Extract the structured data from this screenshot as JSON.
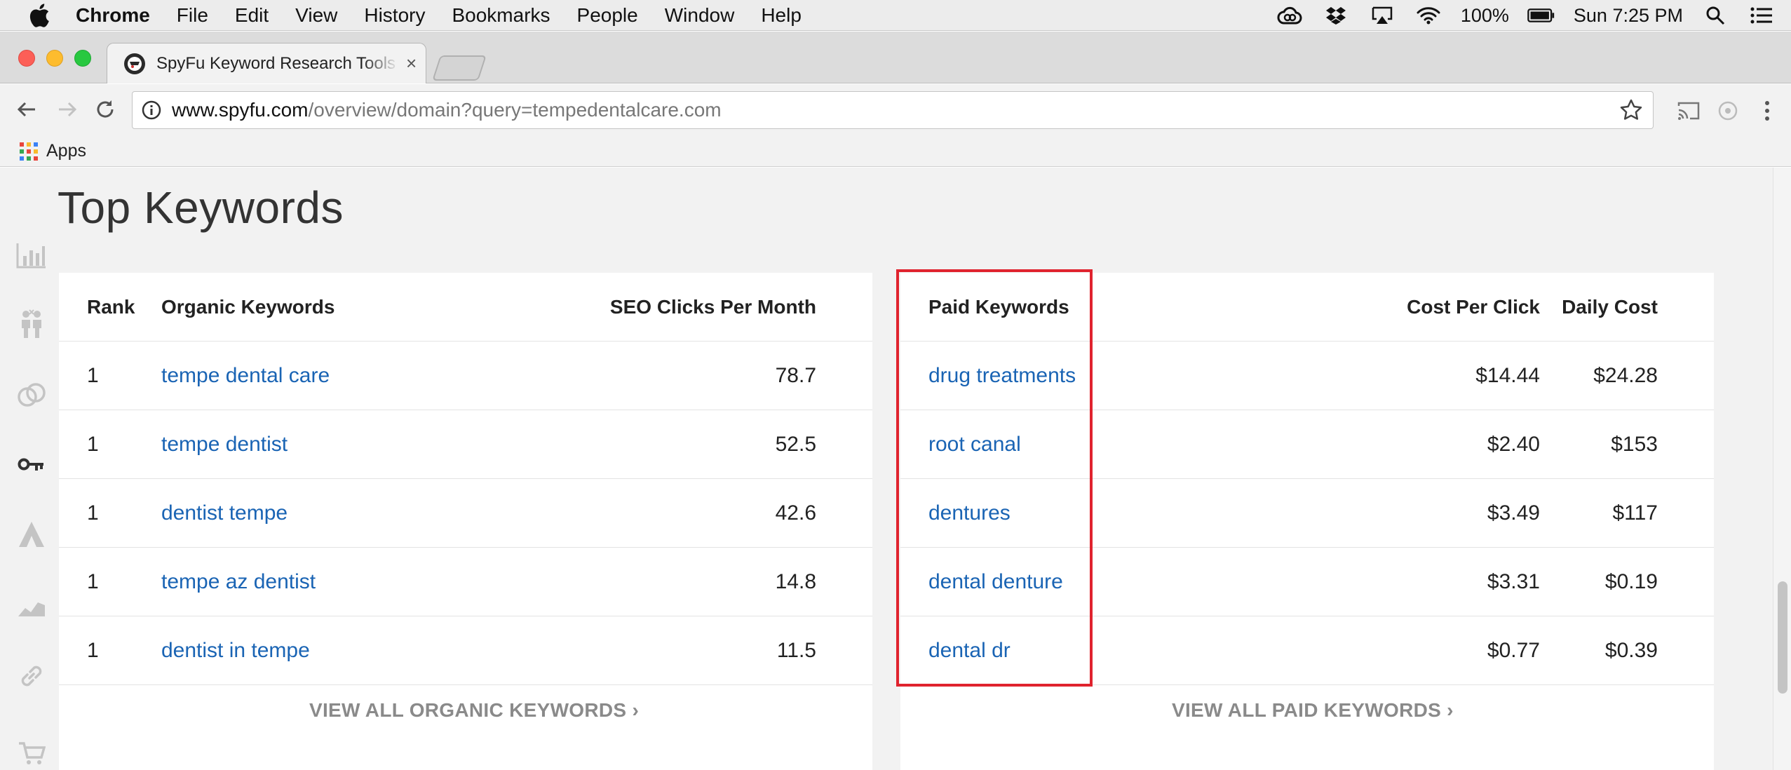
{
  "menubar": {
    "app_name": "Chrome",
    "items": [
      "File",
      "Edit",
      "View",
      "History",
      "Bookmarks",
      "People",
      "Window",
      "Help"
    ],
    "battery": "100%",
    "clock": "Sun 7:25 PM",
    "icons": [
      "apple-icon",
      "creative-cloud-icon",
      "dropbox-icon",
      "airplay-icon",
      "wifi-icon",
      "battery-icon",
      "spotlight-icon",
      "notification-center-icon"
    ]
  },
  "browser": {
    "tab_title": "SpyFu Keyword Research Tools",
    "tab_close": "×",
    "url_host": "www.spyfu.com",
    "url_path": "/overview/domain?query=tempedentalcare.com",
    "bookmarks": {
      "apps_label": "Apps"
    },
    "colors": {
      "red": "#fc5f57",
      "yellow": "#fdbc2e",
      "green": "#28c840"
    }
  },
  "sidebar": {
    "icons": [
      "bar-chart-icon",
      "competitors-icon",
      "kombat-rings-icon",
      "key-icon",
      "adwords-icon",
      "area-chart-icon",
      "link-icon",
      "cart-icon"
    ]
  },
  "page": {
    "title": "Top Keywords",
    "organic": {
      "headers": {
        "rank": "Rank",
        "keyword": "Organic Keywords",
        "clicks": "SEO Clicks Per Month"
      },
      "rows": [
        {
          "rank": "1",
          "keyword": "tempe dental care",
          "clicks": "78.7"
        },
        {
          "rank": "1",
          "keyword": "tempe dentist",
          "clicks": "52.5"
        },
        {
          "rank": "1",
          "keyword": "dentist tempe",
          "clicks": "42.6"
        },
        {
          "rank": "1",
          "keyword": "tempe az dentist",
          "clicks": "14.8"
        },
        {
          "rank": "1",
          "keyword": "dentist in tempe",
          "clicks": "11.5"
        }
      ],
      "view_all": "VIEW ALL ORGANIC KEYWORDS ›"
    },
    "paid": {
      "headers": {
        "keyword": "Paid Keywords",
        "cpc": "Cost Per Click",
        "daily": "Daily Cost"
      },
      "rows": [
        {
          "keyword": "drug treatments",
          "cpc": "$14.44",
          "daily": "$24.28"
        },
        {
          "keyword": "root canal",
          "cpc": "$2.40",
          "daily": "$153"
        },
        {
          "keyword": "dentures",
          "cpc": "$3.49",
          "daily": "$117"
        },
        {
          "keyword": "dental denture",
          "cpc": "$3.31",
          "daily": "$0.19"
        },
        {
          "keyword": "dental dr",
          "cpc": "$0.77",
          "daily": "$0.39"
        }
      ],
      "view_all": "VIEW ALL PAID KEYWORDS ›"
    },
    "colors": {
      "link": "#1a64b4",
      "highlight": "#e0232e",
      "background": "#f2f2f2"
    }
  }
}
